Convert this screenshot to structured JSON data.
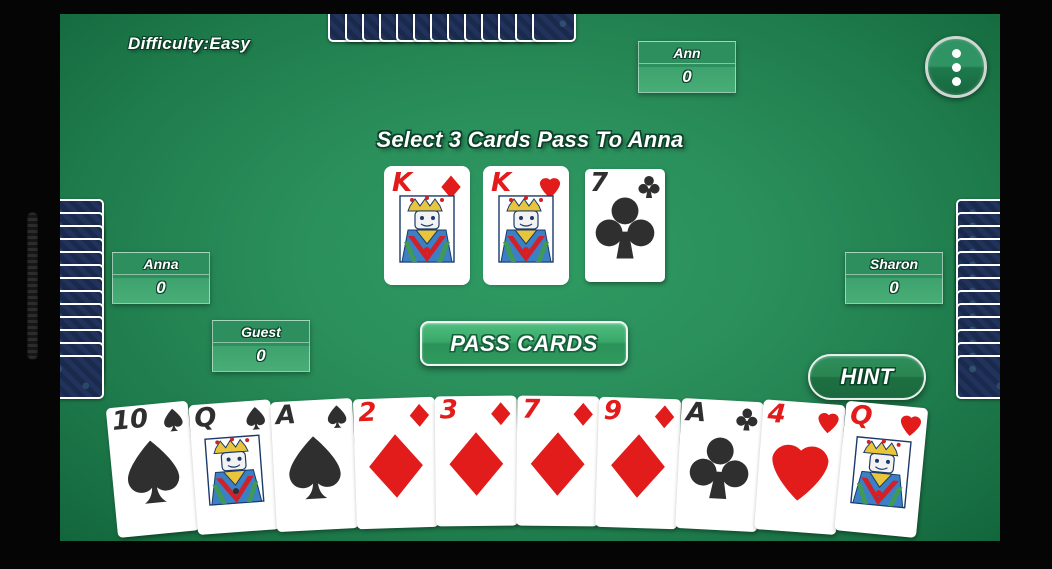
{
  "hud": {
    "difficulty_label": "Difficulty:Easy",
    "prompt": "Select 3 Cards Pass To Anna",
    "menu_icon": "three-dots-vertical-icon"
  },
  "scores": [
    {
      "id": "ann",
      "name": "Ann",
      "value": "0"
    },
    {
      "id": "anna",
      "name": "Anna",
      "value": "0"
    },
    {
      "id": "sharon",
      "name": "Sharon",
      "value": "0"
    },
    {
      "id": "guest",
      "name": "Guest",
      "value": "0"
    }
  ],
  "buttons": {
    "pass_cards": "PASS CARDS",
    "hint": "HINT"
  },
  "selected_cards": [
    {
      "rank": "K",
      "suit": "diamond",
      "suit_glyph": "♦",
      "color": "#e21b1b",
      "court": true,
      "selected": true
    },
    {
      "rank": "K",
      "suit": "heart",
      "suit_glyph": "♥",
      "color": "#e21b1b",
      "court": true,
      "selected": true
    },
    {
      "rank": "7",
      "suit": "club",
      "suit_glyph": "♣",
      "color": "#2f2f2f",
      "court": false,
      "selected": false
    }
  ],
  "hand": [
    {
      "rank": "10",
      "suit": "spade",
      "suit_glyph": "♠",
      "color": "#2f2f2f",
      "court": false
    },
    {
      "rank": "Q",
      "suit": "spade",
      "suit_glyph": "♠",
      "color": "#2f2f2f",
      "court": true
    },
    {
      "rank": "A",
      "suit": "spade",
      "suit_glyph": "♠",
      "color": "#2f2f2f",
      "court": false
    },
    {
      "rank": "2",
      "suit": "diamond",
      "suit_glyph": "♦",
      "color": "#e21b1b",
      "court": false
    },
    {
      "rank": "3",
      "suit": "diamond",
      "suit_glyph": "♦",
      "color": "#e21b1b",
      "court": false
    },
    {
      "rank": "7",
      "suit": "diamond",
      "suit_glyph": "♦",
      "color": "#e21b1b",
      "court": false
    },
    {
      "rank": "9",
      "suit": "diamond",
      "suit_glyph": "♦",
      "color": "#e21b1b",
      "court": false
    },
    {
      "rank": "A",
      "suit": "club",
      "suit_glyph": "♣",
      "color": "#2f2f2f",
      "court": false
    },
    {
      "rank": "4",
      "suit": "heart",
      "suit_glyph": "♥",
      "color": "#e21b1b",
      "court": false
    },
    {
      "rank": "Q",
      "suit": "heart",
      "suit_glyph": "♥",
      "color": "#e21b1b",
      "court": true
    }
  ],
  "opponent_hands": {
    "top": {
      "count": 13,
      "face": "down"
    },
    "left": {
      "count": 13,
      "face": "down"
    },
    "right": {
      "count": 13,
      "face": "down"
    }
  },
  "colors": {
    "felt_green": "#2a8f5b",
    "card_red": "#e21b1b",
    "card_black": "#2f2f2f",
    "card_back": "#1b2b50",
    "bezel": "#050505"
  }
}
